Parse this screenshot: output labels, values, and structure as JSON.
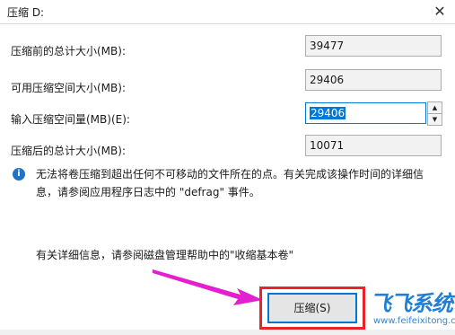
{
  "window": {
    "title": "压缩 D:",
    "close_glyph": "✕"
  },
  "fields": [
    {
      "label": "压缩前的总计大小(MB):",
      "value": "39477"
    },
    {
      "label": "可用压缩空间大小(MB):",
      "value": "29406"
    },
    {
      "label": "输入压缩空间量(MB)(E):",
      "value": "29406"
    },
    {
      "label": "压缩后的总计大小(MB):",
      "value": "10071"
    }
  ],
  "spinner": {
    "up": "▲",
    "down": "▼"
  },
  "info": {
    "icon": "i",
    "text": "无法将卷压缩到超出任何不可移动的文件所在的点。有关完成该操作时间的详细信息，请参阅应用程序日志中的 \"defrag\" 事件。"
  },
  "details_text": "有关详细信息，请参阅磁盘管理帮助中的\"收缩基本卷\"",
  "buttons": {
    "shrink": "压缩(S)"
  },
  "watermark": {
    "brand": "飞飞系统",
    "url": "www.feifeixitong.com"
  },
  "colors": {
    "accent": "#0078d7",
    "highlight": "#e8232a",
    "arrow": "#e41fd0",
    "watermark": "#1f7ed6"
  }
}
